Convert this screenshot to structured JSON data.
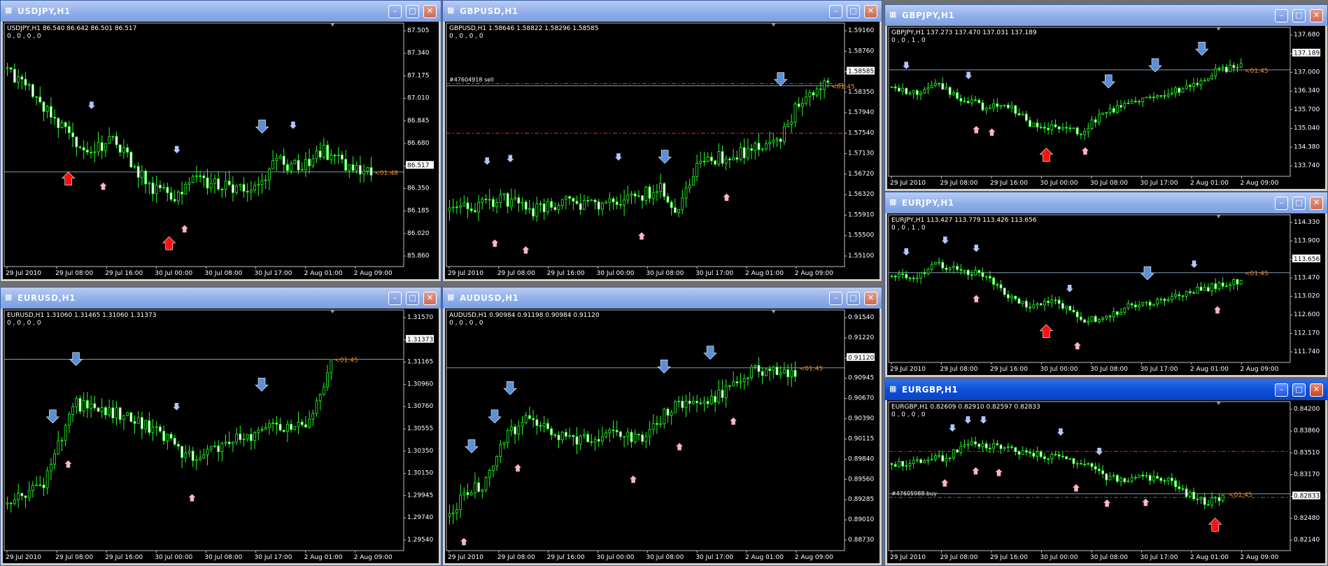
{
  "colors": {
    "bull_candle": "#22ff22",
    "bear_candle": "#ffffff",
    "price_line": "#7f9db9",
    "time_marker": "#ff8c1a",
    "up_arrow_light": "#ffb6c1",
    "down_arrow_light": "#b0c8ff",
    "down_arrow_big": "#5b8fd6",
    "up_arrow_big": "#ff1010",
    "order_sell_line": "#2e8b57",
    "order_stop_line": "#ff2020",
    "order_buy_line": "#2e8b57"
  },
  "windows": [
    {
      "id": "usdjpy",
      "title": "USDJPY,H1",
      "active": false,
      "header": "USDJPY,H1  86.540 86.642 86.501 86.517",
      "subheader": "0 , 0 , 0 , 0",
      "price_axis": [
        "87.505",
        "87.340",
        "87.175",
        "87.010",
        "86.845",
        "86.680",
        "86.517",
        "86.350",
        "86.185",
        "86.020",
        "85.860"
      ],
      "current_price": "86.517",
      "time_left": "01:48",
      "time_axis": [
        "29 Jul 2010",
        "29 Jul 08:00",
        "29 Jul 16:00",
        "30 Jul 00:00",
        "30 Jul 08:00",
        "30 Jul 17:00",
        "2 Aug 01:00",
        "2 Aug 09:00"
      ],
      "order_lines": []
    },
    {
      "id": "gbpusd",
      "title": "GBPUSD,H1",
      "active": false,
      "header": "GBPUSD,H1  1.58646 1.58822 1.58296 1.58585",
      "subheader": "0 , 0 , 0 , 0",
      "price_axis": [
        "1.59160",
        "1.58760",
        "1.58585",
        "1.58350",
        "1.57940",
        "1.57540",
        "1.57130",
        "1.56720",
        "1.56320",
        "1.55910",
        "1.55500",
        "1.55100"
      ],
      "current_price": "1.58585",
      "time_left": "01:45",
      "time_axis": [
        "29 Jul 2010",
        "29 Jul 08:00",
        "29 Jul 16:00",
        "30 Jul 00:00",
        "30 Jul 08:00",
        "30 Jul 17:00",
        "2 Aug 01:00",
        "2 Aug 09:00"
      ],
      "order_lines": [
        {
          "label": "#47604918 sell"
        }
      ]
    },
    {
      "id": "gbpjpy",
      "title": "GBPJPY,H1",
      "active": false,
      "header": "GBPJPY,H1  137.273 137.470 137.031 137.189",
      "subheader": "0 , 0 , 1 , 0",
      "price_axis": [
        "137.680",
        "137.189",
        "137.000",
        "136.340",
        "135.700",
        "135.040",
        "134.380",
        "133.740"
      ],
      "current_price": "137.189",
      "time_left": "01:45",
      "time_axis": [
        "29 Jul 2010",
        "29 Jul 08:00",
        "29 Jul 16:00",
        "30 Jul 00:00",
        "30 Jul 08:00",
        "30 Jul 17:00",
        "2 Aug 01:00",
        "2 Aug 09:00"
      ],
      "order_lines": []
    },
    {
      "id": "eurjpy",
      "title": "EURJPY,H1",
      "active": false,
      "header": "EURJPY,H1  113.427 113.779 113.426 113.656",
      "subheader": "0 , 0 , 1 , 0",
      "price_axis": [
        "114.330",
        "113.900",
        "113.656",
        "113.470",
        "113.020",
        "112.600",
        "112.170",
        "111.740"
      ],
      "current_price": "113.656",
      "time_left": "01:45",
      "time_axis": [
        "29 Jul 2010",
        "29 Jul 08:00",
        "29 Jul 16:00",
        "30 Jul 00:00",
        "30 Jul 08:00",
        "30 Jul 17:00",
        "2 Aug 01:00",
        "2 Aug 09:00"
      ],
      "order_lines": []
    },
    {
      "id": "eurusd",
      "title": "EURUSD,H1",
      "active": false,
      "header": "EURUSD,H1  1.31060 1.31465 1.31060 1.31373",
      "subheader": "0 , 0 , 0 , 0",
      "price_axis": [
        "1.31570",
        "1.31373",
        "1.31165",
        "1.30960",
        "1.30760",
        "1.30555",
        "1.30350",
        "1.30150",
        "1.29945",
        "1.29740",
        "1.29540"
      ],
      "current_price": "1.31373",
      "time_left": "01:45",
      "time_axis": [
        "29 Jul 2010",
        "29 Jul 08:00",
        "29 Jul 16:00",
        "30 Jul 00:00",
        "30 Jul 08:00",
        "30 Jul 17:00",
        "2 Aug 01:00",
        "2 Aug 09:00"
      ],
      "order_lines": []
    },
    {
      "id": "audusd",
      "title": "AUDUSD,H1",
      "active": false,
      "header": "AUDUSD,H1  0.90984 0.91198 0.90984 0.91120",
      "subheader": "0 , 0 , 0 , 0",
      "price_axis": [
        "0.91540",
        "0.91220",
        "0.91120",
        "0.90945",
        "0.90670",
        "0.90390",
        "0.90115",
        "0.89840",
        "0.89560",
        "0.89285",
        "0.89010",
        "0.88730"
      ],
      "current_price": "0.91120",
      "time_left": "01:45",
      "time_axis": [
        "29 Jul 2010",
        "29 Jul 08:00",
        "29 Jul 16:00",
        "30 Jul 00:00",
        "30 Jul 08:00",
        "30 Jul 17:00",
        "2 Aug 01:00",
        "2 Aug 09:00"
      ],
      "order_lines": []
    },
    {
      "id": "eurgbp",
      "title": "EURGBP,H1",
      "active": true,
      "header": "EURGBP,H1  0.82609 0.82910 0.82597 0.82833",
      "subheader": "0 , 0 , 0 , 0",
      "price_axis": [
        "0.84200",
        "0.83860",
        "0.83510",
        "0.83170",
        "0.82833",
        "0.82480",
        "0.82140"
      ],
      "current_price": "0.82833",
      "time_left": "01:45",
      "time_axis": [
        "29 Jul 2010",
        "29 Jul 08:00",
        "29 Jul 16:00",
        "30 Jul 00:00",
        "30 Jul 08:00",
        "30 Jul 17:00",
        "2 Aug 01:00",
        "2 Aug 09:00"
      ],
      "order_lines": [
        {
          "label": "#47605988 buy"
        }
      ]
    }
  ]
}
